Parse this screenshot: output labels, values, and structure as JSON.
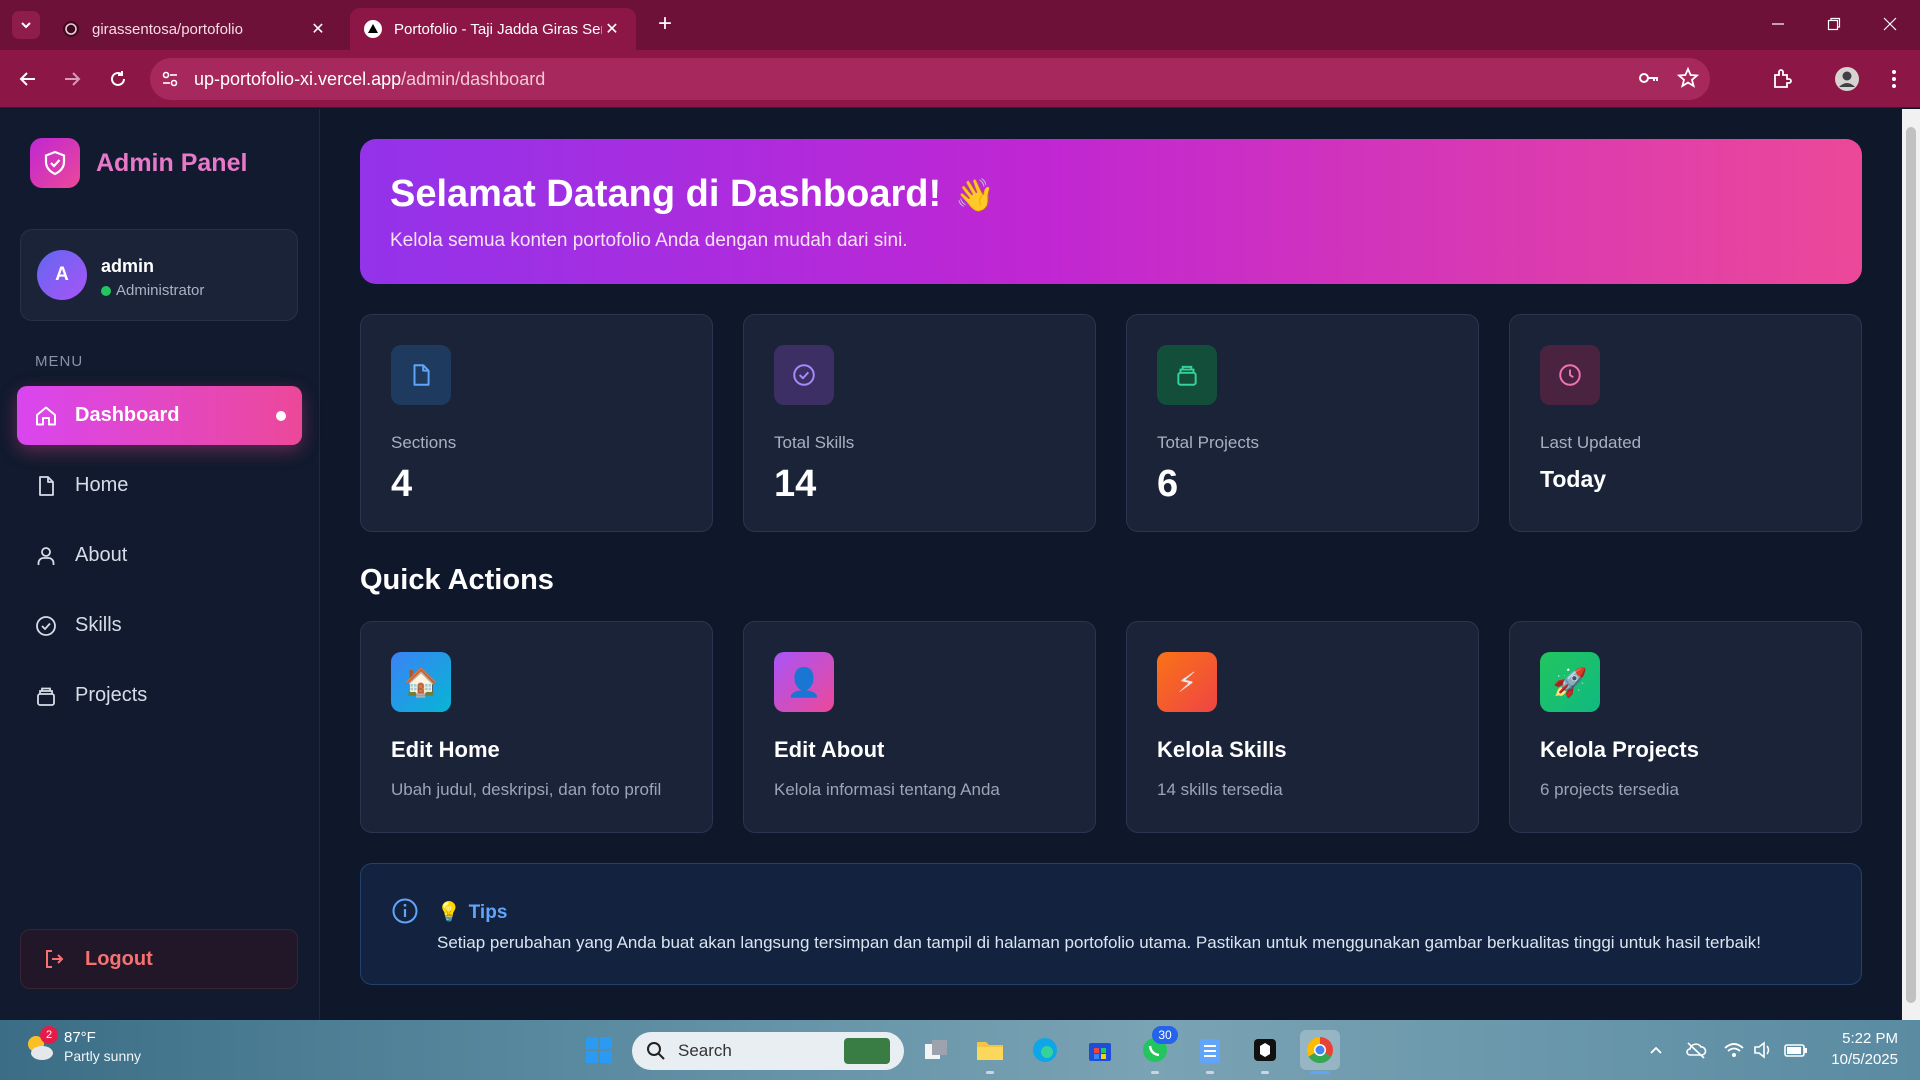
{
  "browser": {
    "tabs": [
      {
        "title": "girassentosa/portofolio",
        "active": false
      },
      {
        "title": "Portofolio - Taji Jadda Giras Sen",
        "active": true
      }
    ],
    "url_host": "up-portofolio-xi.vercel.app",
    "url_path": "/admin/dashboard"
  },
  "sidebar": {
    "brand": "Admin Panel",
    "user": {
      "initial": "A",
      "name": "admin",
      "role": "Administrator"
    },
    "menu_label": "MENU",
    "items": [
      {
        "label": "Dashboard",
        "icon": "home-icon",
        "active": true
      },
      {
        "label": "Home",
        "icon": "file-icon",
        "active": false
      },
      {
        "label": "About",
        "icon": "user-icon",
        "active": false
      },
      {
        "label": "Skills",
        "icon": "check-circle-icon",
        "active": false
      },
      {
        "label": "Projects",
        "icon": "inbox-icon",
        "active": false
      }
    ],
    "logout": "Logout"
  },
  "welcome": {
    "title": "Selamat Datang di Dashboard!",
    "emoji": "👋",
    "subtitle": "Kelola semua konten portofolio Anda dengan mudah dari sini."
  },
  "stats": [
    {
      "label": "Sections",
      "value": "4",
      "icon": "file-icon",
      "color": "#60a5fa"
    },
    {
      "label": "Total Skills",
      "value": "14",
      "icon": "check-circle-icon",
      "color": "#a78bfa"
    },
    {
      "label": "Total Projects",
      "value": "6",
      "icon": "inbox-icon",
      "color": "#34d399"
    },
    {
      "label": "Last Updated",
      "value": "Today",
      "icon": "clock-icon",
      "color": "#f472b6"
    }
  ],
  "quick_actions": {
    "title": "Quick Actions",
    "items": [
      {
        "title": "Edit Home",
        "desc": "Ubah judul, deskripsi, dan foto profil",
        "emoji": "🏠"
      },
      {
        "title": "Edit About",
        "desc": "Kelola informasi tentang Anda",
        "emoji": "👤"
      },
      {
        "title": "Kelola Skills",
        "desc": "14 skills tersedia",
        "emoji": "⚡"
      },
      {
        "title": "Kelola Projects",
        "desc": "6 projects tersedia",
        "emoji": "🚀"
      }
    ]
  },
  "tips": {
    "bulb": "💡",
    "title": "Tips",
    "text": "Setiap perubahan yang Anda buat akan langsung tersimpan dan tampil di halaman portofolio utama. Pastikan untuk menggunakan gambar berkualitas tinggi untuk hasil terbaik!"
  },
  "taskbar": {
    "weather_temp": "87°F",
    "weather_condition": "Partly sunny",
    "weather_badge": "2",
    "search_placeholder": "Search",
    "whatsapp_badge": "30",
    "time": "5:22 PM",
    "date": "10/5/2025"
  }
}
